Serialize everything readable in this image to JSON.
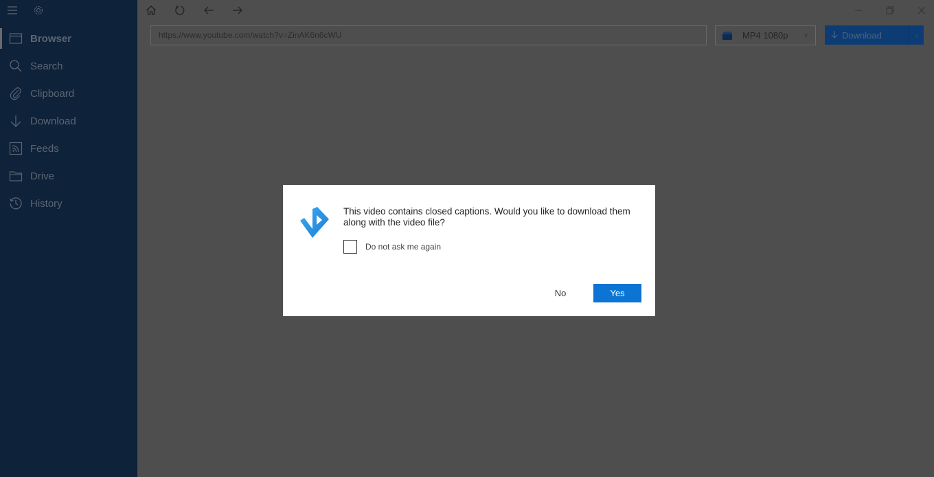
{
  "sidebar": {
    "items": [
      {
        "label": "Browser",
        "icon": "browser-icon",
        "active": true
      },
      {
        "label": "Search",
        "icon": "search-icon"
      },
      {
        "label": "Clipboard",
        "icon": "paperclip-icon"
      },
      {
        "label": "Download",
        "icon": "download-arrow-icon"
      },
      {
        "label": "Feeds",
        "icon": "rss-icon"
      },
      {
        "label": "Drive",
        "icon": "folder-icon"
      },
      {
        "label": "History",
        "icon": "history-icon"
      }
    ]
  },
  "toolbar": {
    "url": "https://www.youtube.com/watch?v=ZinAK6n6cWU",
    "format": "MP4 1080p",
    "download_label": "Download"
  },
  "dialog": {
    "message": "This video contains closed captions. Would you like to download them along with the video file?",
    "checkbox_label": "Do not ask me again",
    "checkbox_checked": false,
    "no_label": "No",
    "yes_label": "Yes"
  },
  "colors": {
    "sidebar_bg": "#0e2239",
    "accent": "#0b74d4",
    "overlay_bg": "#4e4e4e"
  }
}
